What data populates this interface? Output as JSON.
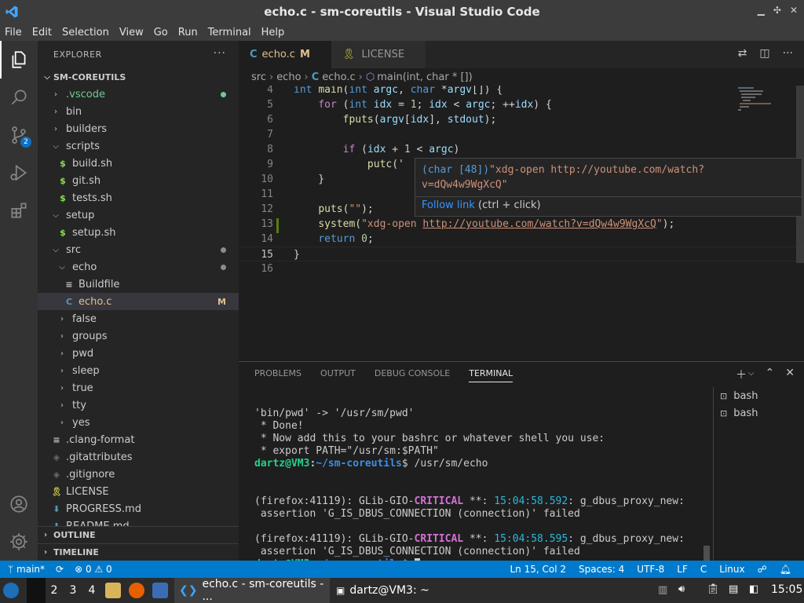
{
  "window": {
    "title": "echo.c - sm-coreutils - Visual Studio Code"
  },
  "menu": [
    "File",
    "Edit",
    "Selection",
    "View",
    "Go",
    "Run",
    "Terminal",
    "Help"
  ],
  "activity": {
    "scm_badge": "2"
  },
  "explorer": {
    "title": "EXPLORER",
    "root": "SM-COREUTILS",
    "items": [
      {
        "label": ".vscode",
        "type": "folder",
        "open": false,
        "depth": 1,
        "color": "#73c991",
        "dot": "#73c991"
      },
      {
        "label": "bin",
        "type": "folder",
        "open": false,
        "depth": 1
      },
      {
        "label": "builders",
        "type": "folder",
        "open": false,
        "depth": 1
      },
      {
        "label": "scripts",
        "type": "folder",
        "open": true,
        "depth": 1
      },
      {
        "label": "build.sh",
        "type": "sh",
        "depth": 2
      },
      {
        "label": "git.sh",
        "type": "sh",
        "depth": 2
      },
      {
        "label": "tests.sh",
        "type": "sh",
        "depth": 2
      },
      {
        "label": "setup",
        "type": "folder",
        "open": true,
        "depth": 1
      },
      {
        "label": "setup.sh",
        "type": "sh",
        "depth": 2
      },
      {
        "label": "src",
        "type": "folder",
        "open": true,
        "depth": 1,
        "dot": "#8c8c8c"
      },
      {
        "label": "echo",
        "type": "folder",
        "open": true,
        "depth": 2,
        "dot": "#8c8c8c"
      },
      {
        "label": "Buildfile",
        "type": "lines",
        "depth": 3
      },
      {
        "label": "echo.c",
        "type": "c",
        "depth": 3,
        "selected": true,
        "color": "#e2c08d",
        "mod": "M"
      },
      {
        "label": "false",
        "type": "folder",
        "open": false,
        "depth": 2
      },
      {
        "label": "groups",
        "type": "folder",
        "open": false,
        "depth": 2
      },
      {
        "label": "pwd",
        "type": "folder",
        "open": false,
        "depth": 2
      },
      {
        "label": "sleep",
        "type": "folder",
        "open": false,
        "depth": 2
      },
      {
        "label": "true",
        "type": "folder",
        "open": false,
        "depth": 2
      },
      {
        "label": "tty",
        "type": "folder",
        "open": false,
        "depth": 2
      },
      {
        "label": "yes",
        "type": "folder",
        "open": false,
        "depth": 2
      },
      {
        "label": ".clang-format",
        "type": "lines",
        "depth": 1
      },
      {
        "label": ".gitattributes",
        "type": "git",
        "depth": 1
      },
      {
        "label": ".gitignore",
        "type": "git",
        "depth": 1
      },
      {
        "label": "LICENSE",
        "type": "license",
        "depth": 1
      },
      {
        "label": "PROGRESS.md",
        "type": "md",
        "depth": 1
      },
      {
        "label": "README.md",
        "type": "md",
        "depth": 1
      }
    ],
    "outline": "OUTLINE",
    "timeline": "TIMELINE"
  },
  "tabs": [
    {
      "label": "echo.c",
      "badge": "M",
      "active": true
    },
    {
      "label": "LICENSE",
      "active": false
    }
  ],
  "breadcrumb": [
    "src",
    "echo",
    "echo.c",
    "main(int, char * [])"
  ],
  "code": [
    {
      "n": "4",
      "text": "int main(int argc, char *argv[]) {"
    },
    {
      "n": "5",
      "text": "    for (int idx = 1; idx < argc; ++idx) {"
    },
    {
      "n": "6",
      "text": "        fputs(argv[idx], stdout);"
    },
    {
      "n": "7",
      "text": ""
    },
    {
      "n": "8",
      "text": "        if (idx + 1 < argc)"
    },
    {
      "n": "9",
      "text": "            putc('"
    },
    {
      "n": "10",
      "text": "    }"
    },
    {
      "n": "11",
      "text": ""
    },
    {
      "n": "12",
      "text": "    puts(\"\");"
    },
    {
      "n": "13",
      "text": "    system(\"xdg-open http://youtube.com/watch?v=dQw4w9WgXcQ\");"
    },
    {
      "n": "14",
      "text": "    return 0;"
    },
    {
      "n": "15",
      "text": "}"
    },
    {
      "n": "16",
      "text": ""
    }
  ],
  "hover": {
    "type": "(char [48])",
    "value_line1": "\"xdg-open http://youtube.com/watch?",
    "value_line2": "v=dQw4w9WgXcQ\"",
    "follow": "Follow link",
    "follow_hint": "(ctrl + click)"
  },
  "panel": {
    "tabs": [
      "PROBLEMS",
      "OUTPUT",
      "DEBUG CONSOLE",
      "TERMINAL"
    ],
    "active_tab": "TERMINAL",
    "terminals": [
      "bash",
      "bash"
    ],
    "prompt_user": "dartz@VM3",
    "prompt_path": "~/sm-coreutils",
    "lines": {
      "l1": "'bin/pwd' -> '/usr/sm/pwd'",
      "l2": " * Done!",
      "l3": " * Now add this to your bashrc or whatever shell you use:",
      "l4": " * export PATH=\"/usr/sm:$PATH\"",
      "cmd": "$ /usr/sm/echo",
      "e1_pre": "(firefox:41119): GLib-GIO-",
      "crit": "CRITICAL",
      "e_mid": " **: ",
      "e1_ts": "15:04:58.592",
      "e_post": ": g_dbus_proxy_new:",
      "e_assert": " assertion 'G_IS_DBUS_CONNECTION (connection)' failed",
      "e2_ts": "15:04:58.595",
      "last": "$ "
    }
  },
  "status": {
    "branch": "main*",
    "errors": "0",
    "warnings": "0",
    "position": "Ln 15, Col 2",
    "spaces": "Spaces: 4",
    "encoding": "UTF-8",
    "eol": "LF",
    "language": "C",
    "os": "Linux"
  },
  "taskbar": {
    "workspaces": [
      "2",
      "3",
      "4"
    ],
    "tasks": [
      "echo.c - sm-coreutils - ...",
      "dartz@VM3: ~"
    ],
    "clock": "15:05"
  },
  "colors": {
    "accent": "#007acc",
    "modified": "#e2c08d",
    "untracked": "#73c991"
  }
}
